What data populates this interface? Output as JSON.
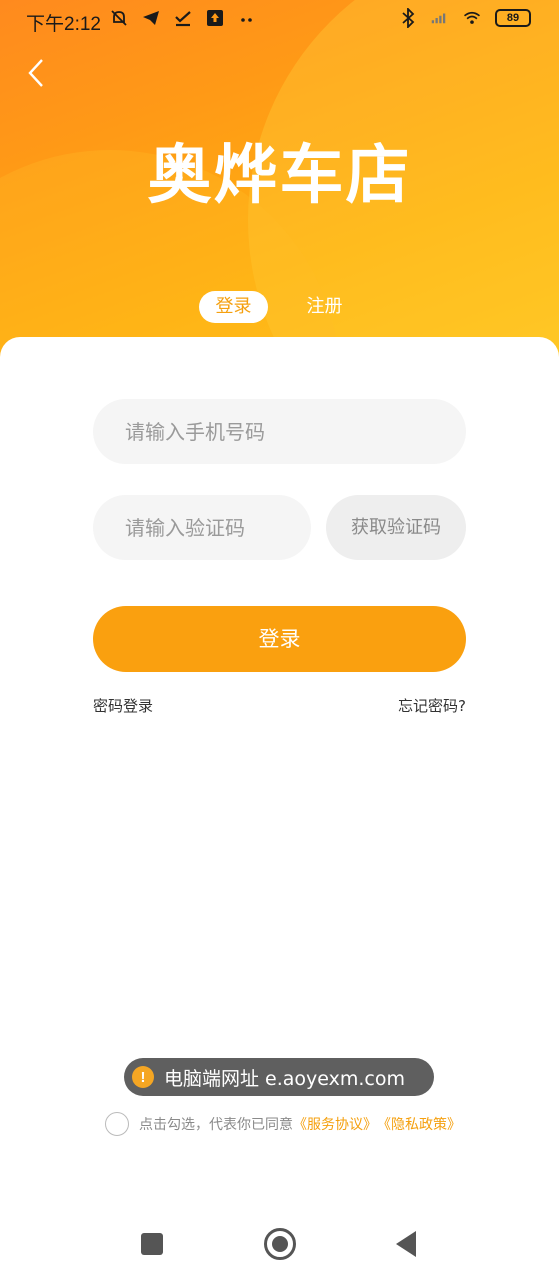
{
  "status_bar": {
    "time": "下午2:12",
    "battery": "89",
    "icons": [
      "mute-icon",
      "telegram-icon",
      "check-icon",
      "upload-icon",
      "more-icon",
      "bluetooth-icon",
      "signal-icon",
      "wifi-icon"
    ]
  },
  "header": {
    "logo_text": "奥烨车店",
    "tabs": {
      "login": "登录",
      "register": "注册"
    }
  },
  "form": {
    "phone_placeholder": "请输入手机号码",
    "code_placeholder": "请输入验证码",
    "get_code_label": "获取验证码",
    "submit_label": "登录",
    "password_login_link": "密码登录",
    "forgot_password_link": "忘记密码?"
  },
  "toast": {
    "text": "电脑端网址 e.aoyexm.com"
  },
  "agreement": {
    "prefix": "点击勾选，代表你已同意",
    "service": "《服务协议》",
    "privacy": "《隐私政策》"
  },
  "colors": {
    "accent": "#FAA00F",
    "header_start": "#FF8A1E",
    "header_end": "#FFC51A"
  }
}
